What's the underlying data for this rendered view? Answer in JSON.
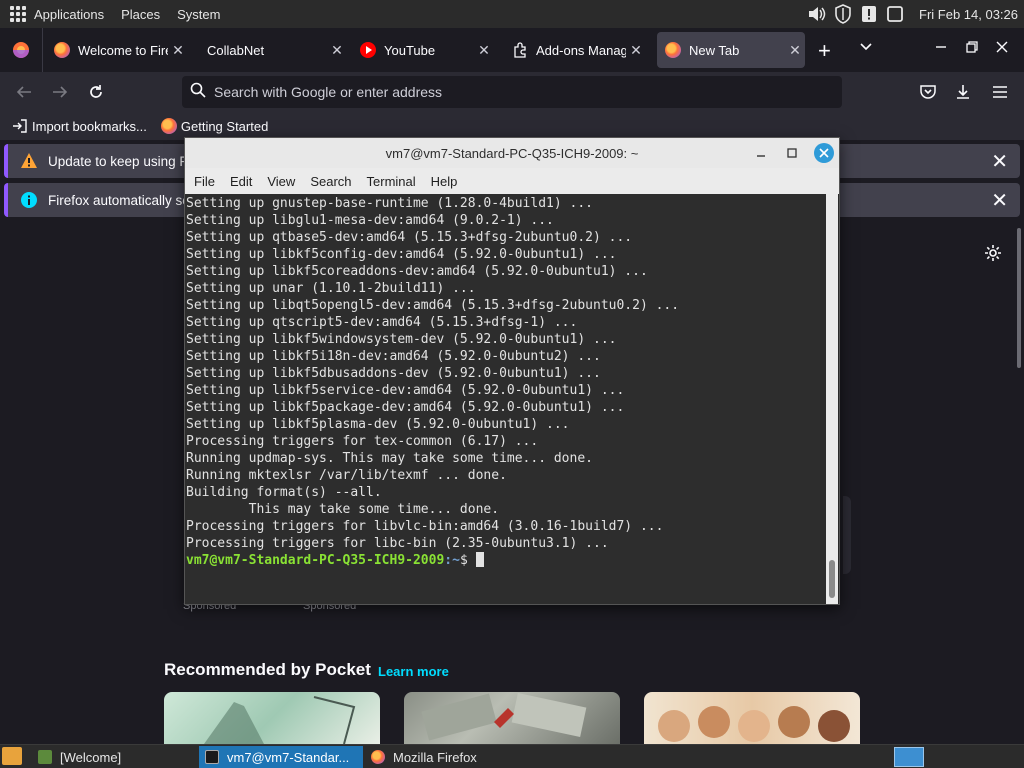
{
  "system_panel": {
    "menus": [
      "Applications",
      "Places",
      "System"
    ],
    "clock": "Fri Feb 14, 03:26",
    "tray_icons": [
      "volume-icon",
      "shield-icon",
      "alert-icon",
      "window-icon"
    ]
  },
  "browser": {
    "tabs": [
      {
        "title": "Welcome to Fire",
        "favicon": "firefox-icon",
        "active": false
      },
      {
        "title": "CollabNet",
        "favicon": "none",
        "active": false
      },
      {
        "title": "YouTube",
        "favicon": "youtube-icon",
        "active": false
      },
      {
        "title": "Add-ons Manag",
        "favicon": "puzzle-icon",
        "active": false
      },
      {
        "title": "New Tab",
        "favicon": "firefox-icon",
        "active": true
      }
    ],
    "url_placeholder": "Search with Google or enter address",
    "bookmarks": [
      "Import bookmarks...",
      "Getting Started"
    ],
    "notices": [
      {
        "text": "Update to keep using F",
        "icon": "warning-icon"
      },
      {
        "text": "Firefox automatically se",
        "icon": "info-icon"
      }
    ],
    "new_tab": {
      "sponsored": [
        "Sponsored",
        "Sponsored"
      ],
      "pocket_title": "Recommended by Pocket",
      "pocket_link": "Learn more"
    }
  },
  "terminal": {
    "title": "vm7@vm7-Standard-PC-Q35-ICH9-2009: ~",
    "menu": [
      "File",
      "Edit",
      "View",
      "Search",
      "Terminal",
      "Help"
    ],
    "lines": [
      "Setting up gnustep-base-runtime (1.28.0-4build1) ...",
      "Setting up libglu1-mesa-dev:amd64 (9.0.2-1) ...",
      "Setting up qtbase5-dev:amd64 (5.15.3+dfsg-2ubuntu0.2) ...",
      "Setting up libkf5config-dev:amd64 (5.92.0-0ubuntu1) ...",
      "Setting up libkf5coreaddons-dev:amd64 (5.92.0-0ubuntu1) ...",
      "Setting up unar (1.10.1-2build11) ...",
      "Setting up libqt5opengl5-dev:amd64 (5.15.3+dfsg-2ubuntu0.2) ...",
      "Setting up qtscript5-dev:amd64 (5.15.3+dfsg-1) ...",
      "Setting up libkf5windowsystem-dev (5.92.0-0ubuntu1) ...",
      "Setting up libkf5i18n-dev:amd64 (5.92.0-0ubuntu2) ...",
      "Setting up libkf5dbusaddons-dev (5.92.0-0ubuntu1) ...",
      "Setting up libkf5service-dev:amd64 (5.92.0-0ubuntu1) ...",
      "Setting up libkf5package-dev:amd64 (5.92.0-0ubuntu1) ...",
      "Setting up libkf5plasma-dev (5.92.0-0ubuntu1) ...",
      "Processing triggers for tex-common (6.17) ...",
      "Running updmap-sys. This may take some time... done.",
      "Running mktexlsr /var/lib/texmf ... done.",
      "Building format(s) --all.",
      "        This may take some time... done.",
      "Processing triggers for libvlc-bin:amd64 (3.0.16-1build7) ...",
      "Processing triggers for libc-bin (2.35-0ubuntu3.1) ..."
    ],
    "prompt_user": "vm7@vm7-Standard-PC-Q35-ICH9-2009",
    "prompt_path": ":~",
    "prompt_symbol": "$"
  },
  "taskbar": {
    "tasks": [
      {
        "label": "[Welcome]",
        "active": false,
        "icon": "app-icon"
      },
      {
        "label": "vm7@vm7-Standar...",
        "active": true,
        "icon": "terminal-icon"
      },
      {
        "label": "Mozilla Firefox",
        "active": false,
        "icon": "firefox-icon"
      }
    ]
  },
  "colors": {
    "accent": "#9059ff",
    "link": "#00ddff",
    "prompt_user": "#8ae234",
    "prompt_path": "#729fcf",
    "task_active": "#1f75b5"
  }
}
